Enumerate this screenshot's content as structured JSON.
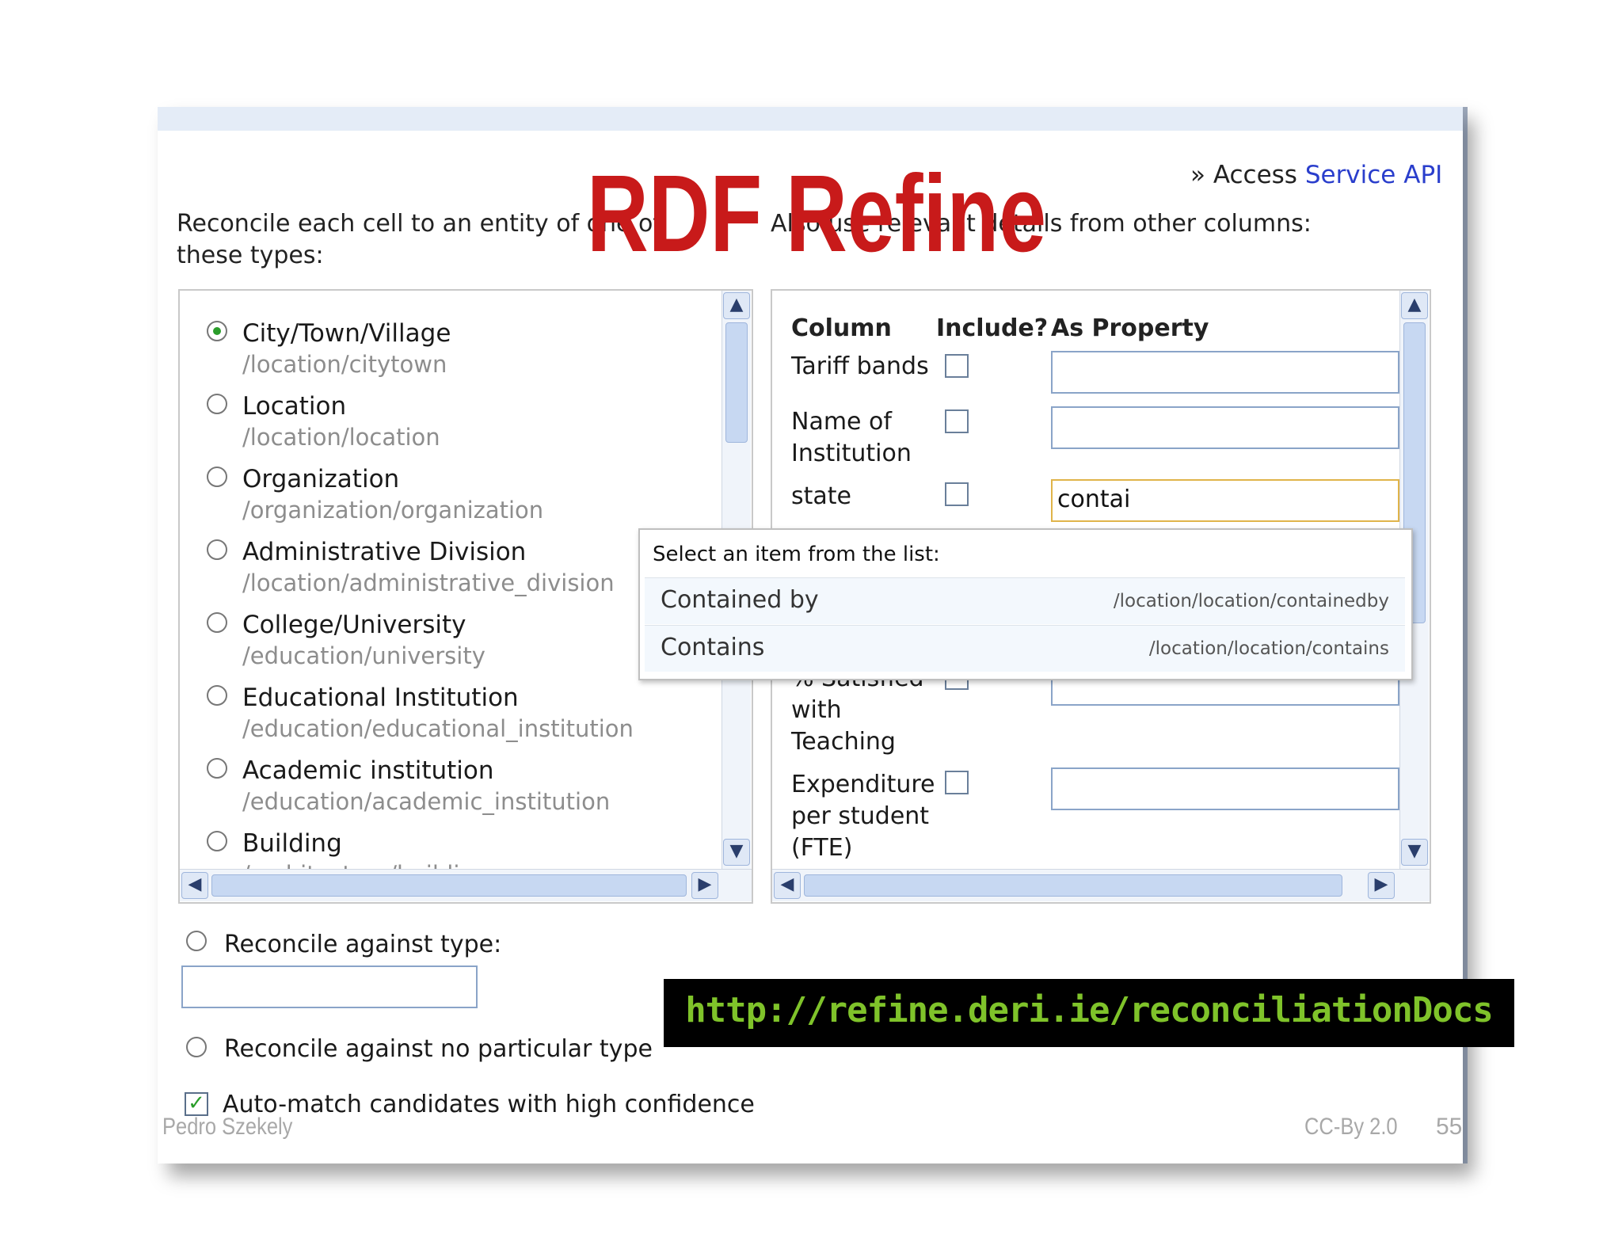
{
  "slide": {
    "title": "RDF Refine",
    "url": "http://refine.deri.ie/reconciliationDocs",
    "author": "Pedro Szekely",
    "license": "CC-By 2.0",
    "page_number": "55",
    "title_color": "#c81a1a",
    "url_color": "#7fc32a"
  },
  "header": {
    "api_prefix": "» Access ",
    "api_link": "Service API",
    "left_heading": "Reconcile each cell to an entity of one of these types:",
    "right_heading": "Also use relevant details from other columns:"
  },
  "types": [
    {
      "name": "City/Town/Village",
      "path": "/location/citytown",
      "selected": true
    },
    {
      "name": "Location",
      "path": "/location/location",
      "selected": false
    },
    {
      "name": "Organization",
      "path": "/organization/organization",
      "selected": false
    },
    {
      "name": "Administrative Division",
      "path": "/location/administrative_division",
      "selected": false
    },
    {
      "name": "College/University",
      "path": "/education/university",
      "selected": false
    },
    {
      "name": "Educational Institution",
      "path": "/education/educational_institution",
      "selected": false
    },
    {
      "name": "Academic institution",
      "path": "/education/academic_institution",
      "selected": false
    },
    {
      "name": "Building",
      "path": "/architecture/building",
      "selected": false
    }
  ],
  "columns_table": {
    "headers": [
      "Column",
      "Include?",
      "As Property"
    ],
    "rows": [
      {
        "column": "Tariff bands",
        "include": false,
        "property": ""
      },
      {
        "column": "Name of Institution",
        "include": false,
        "property": ""
      },
      {
        "column": "state",
        "include": false,
        "property": "contai"
      },
      {
        "column": "% Satisfied with Teaching",
        "include": false,
        "property": ""
      },
      {
        "column": "Expenditure per student (FTE)",
        "include": false,
        "property": ""
      }
    ]
  },
  "suggestions": {
    "prompt": "Select an item from the list:",
    "items": [
      {
        "label": "Contained by",
        "path": "/location/location/containedby"
      },
      {
        "label": "Contains",
        "path": "/location/location/contains"
      }
    ]
  },
  "options": {
    "against_type": "Reconcile against type:",
    "against_type_value": "",
    "no_type": "Reconcile against no particular type",
    "auto_match": "Auto-match candidates with high confidence",
    "auto_match_checked": true
  },
  "icons": {
    "scroll_up": "chevron-up-icon",
    "scroll_down": "chevron-down-icon",
    "scroll_left": "chevron-left-icon",
    "scroll_right": "chevron-right-icon",
    "checkmark": "checkmark-icon"
  }
}
